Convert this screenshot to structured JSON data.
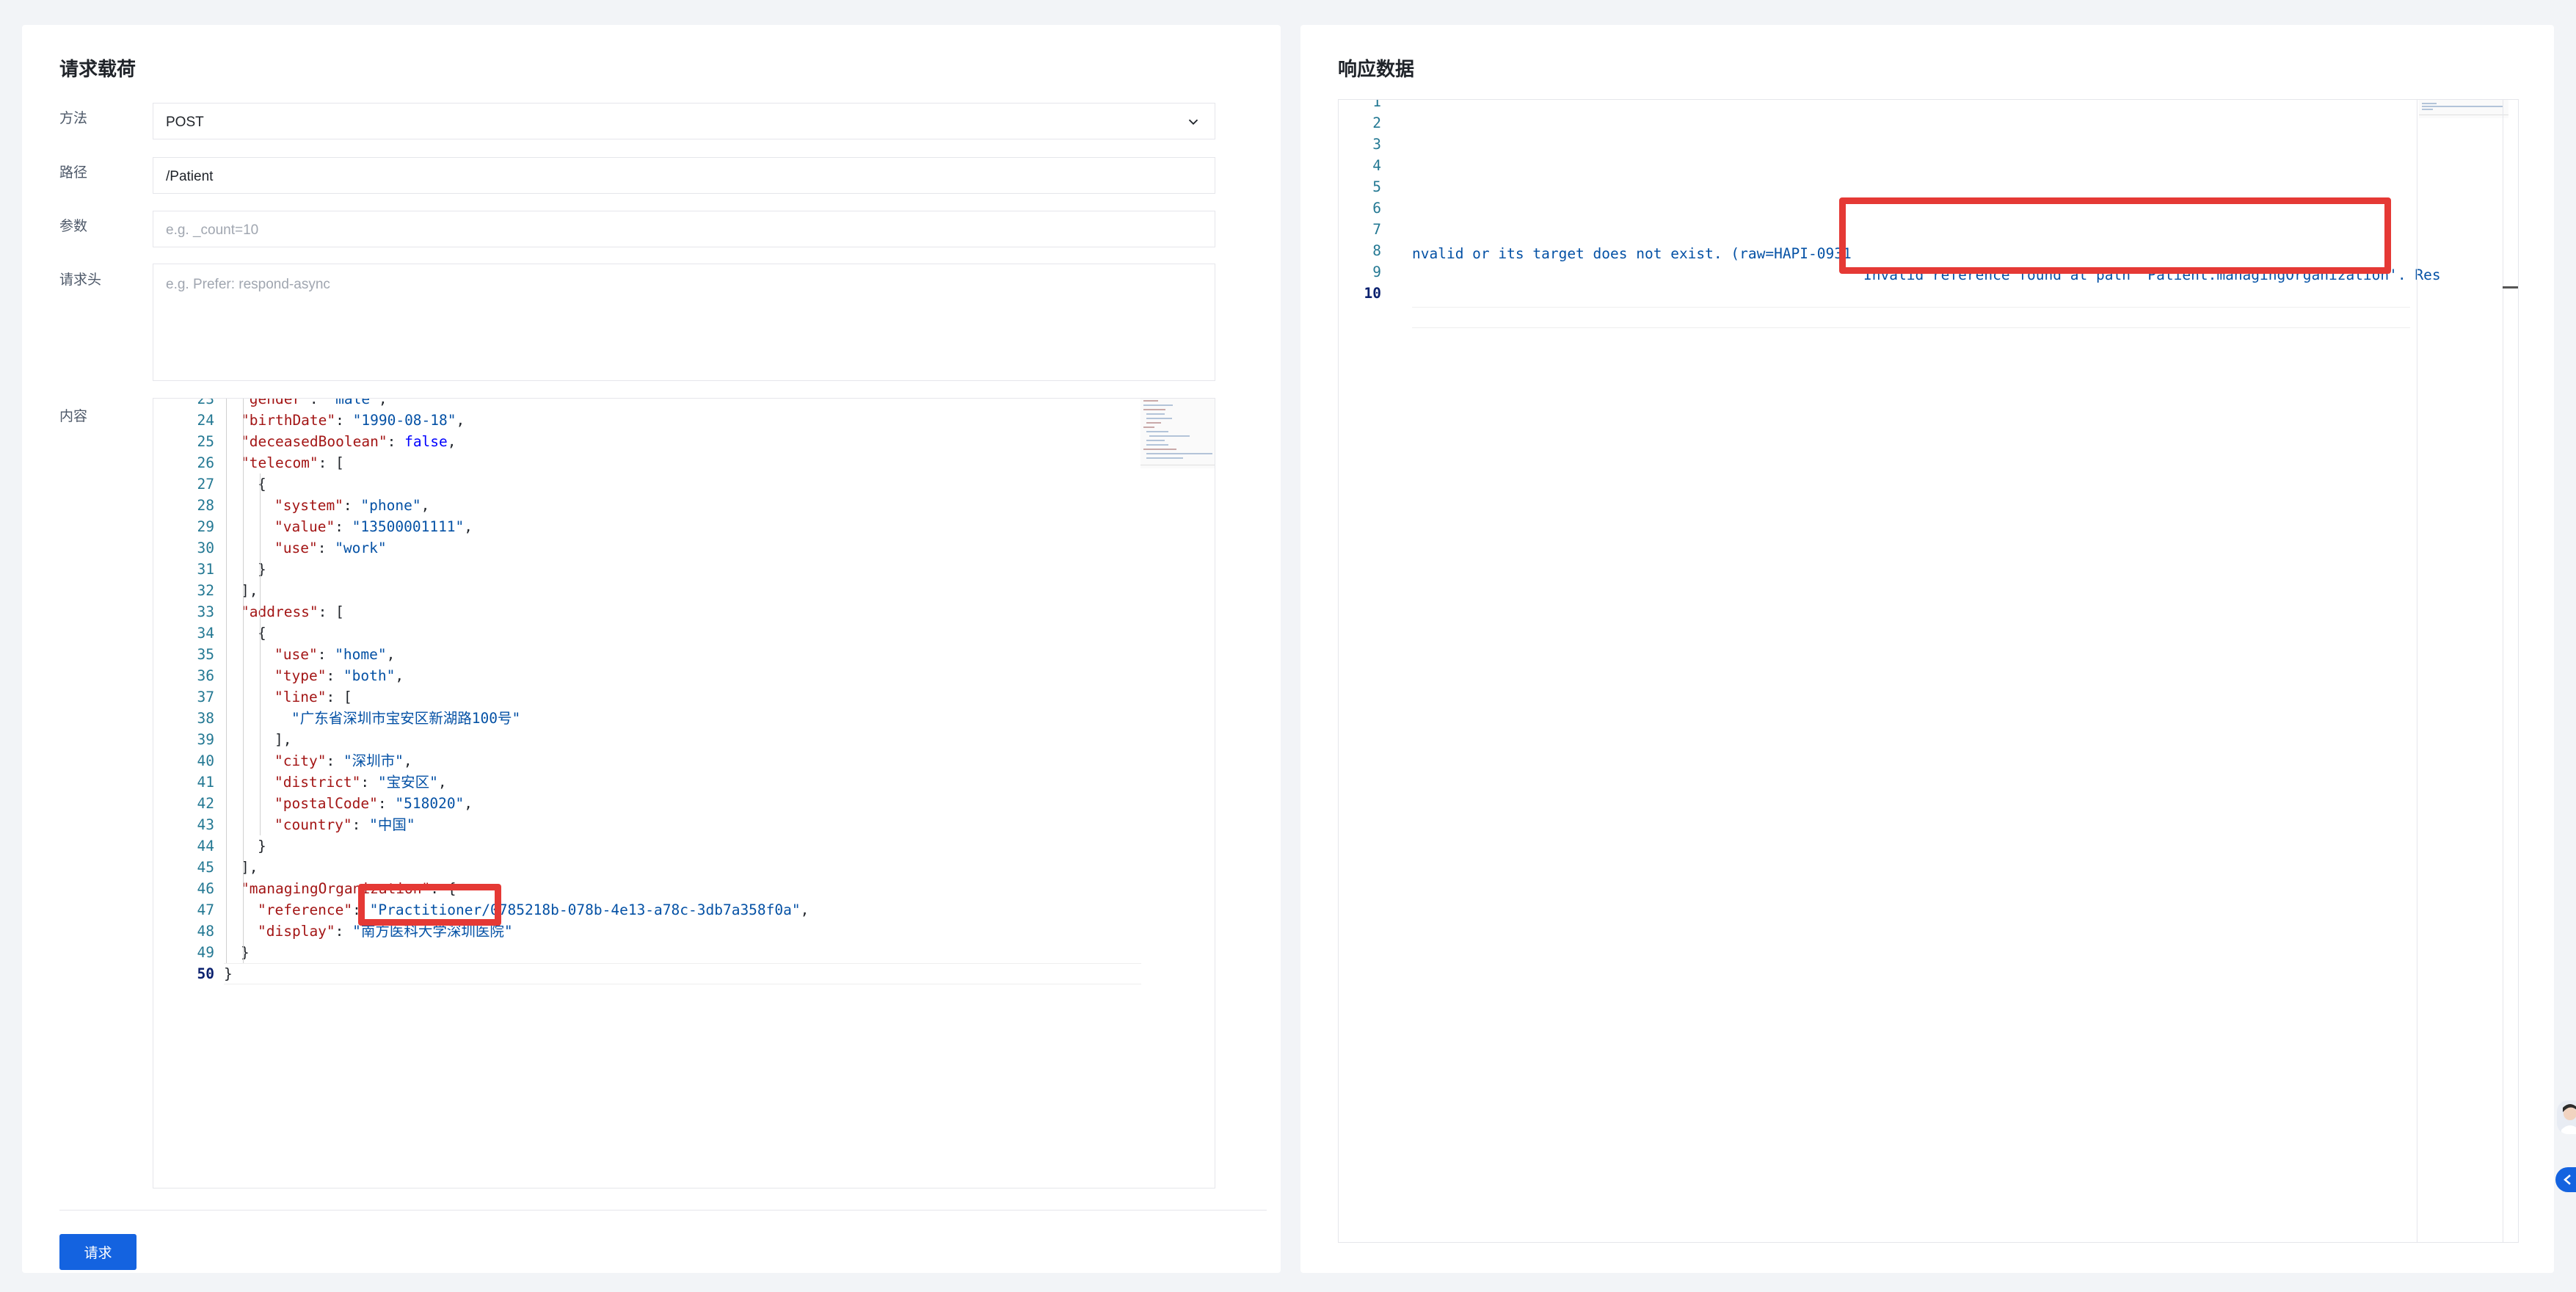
{
  "request": {
    "title": "请求载荷",
    "method_label": "方法",
    "method_value": "POST",
    "path_label": "路径",
    "path_value": "/Patient",
    "params_label": "参数",
    "params_placeholder": "e.g. _count=10",
    "headers_label": "请求头",
    "headers_placeholder": "e.g. Prefer: respond-async",
    "body_label": "内容",
    "submit_label": "请求"
  },
  "response": {
    "title": "响应数据",
    "line_numbers": [
      "1",
      "2",
      "3",
      "4",
      "5",
      "6",
      "7",
      "8",
      "9",
      "10"
    ],
    "line7_a": "nvalid or its target does not exist. (raw=HAPI-0931",
    "line7_b": "Invalid reference found at path 'Patient.managingOrganization'. Res"
  },
  "colors": {
    "accent": "#1463e0",
    "highlight_box": "#e53935",
    "json_key": "#a31515",
    "json_string": "#0451a5",
    "json_keyword": "#0000ff",
    "line_number": "#237893"
  },
  "icons": {
    "method_dropdown": "chevron-down-icon",
    "floating_avatar": "assistant-avatar-icon",
    "floating_button": "chevron-left-icon"
  },
  "body_lines": [
    {
      "n": "23",
      "indent": 1,
      "key": "gender",
      "value": "male",
      "vtype": "str",
      "tail": ","
    },
    {
      "n": "24",
      "indent": 1,
      "key": "birthDate",
      "value": "1990-08-18",
      "vtype": "str",
      "tail": ","
    },
    {
      "n": "25",
      "indent": 1,
      "key": "deceasedBoolean",
      "value": "false",
      "vtype": "kw",
      "tail": ","
    },
    {
      "n": "26",
      "indent": 1,
      "key": "telecom",
      "value": "",
      "vtype": "",
      "tail": "["
    },
    {
      "n": "27",
      "indent": 2,
      "key": "",
      "value": "",
      "vtype": "",
      "tail": "{"
    },
    {
      "n": "28",
      "indent": 3,
      "key": "system",
      "value": "phone",
      "vtype": "str",
      "tail": ","
    },
    {
      "n": "29",
      "indent": 3,
      "key": "value",
      "value": "13500001111",
      "vtype": "str",
      "tail": ","
    },
    {
      "n": "30",
      "indent": 3,
      "key": "use",
      "value": "work",
      "vtype": "str",
      "tail": ""
    },
    {
      "n": "31",
      "indent": 2,
      "key": "",
      "value": "",
      "vtype": "",
      "tail": "}"
    },
    {
      "n": "32",
      "indent": 1,
      "key": "",
      "value": "",
      "vtype": "",
      "tail": "],"
    },
    {
      "n": "33",
      "indent": 1,
      "key": "address",
      "value": "",
      "vtype": "",
      "tail": "["
    },
    {
      "n": "34",
      "indent": 2,
      "key": "",
      "value": "",
      "vtype": "",
      "tail": "{"
    },
    {
      "n": "35",
      "indent": 3,
      "key": "use",
      "value": "home",
      "vtype": "str",
      "tail": ","
    },
    {
      "n": "36",
      "indent": 3,
      "key": "type",
      "value": "both",
      "vtype": "str",
      "tail": ","
    },
    {
      "n": "37",
      "indent": 3,
      "key": "line",
      "value": "",
      "vtype": "",
      "tail": "["
    },
    {
      "n": "38",
      "indent": 4,
      "key": "",
      "value": "广东省深圳市宝安区新湖路100号",
      "vtype": "str",
      "tail": ""
    },
    {
      "n": "39",
      "indent": 3,
      "key": "",
      "value": "",
      "vtype": "",
      "tail": "],"
    },
    {
      "n": "40",
      "indent": 3,
      "key": "city",
      "value": "深圳市",
      "vtype": "str",
      "tail": ","
    },
    {
      "n": "41",
      "indent": 3,
      "key": "district",
      "value": "宝安区",
      "vtype": "str",
      "tail": ","
    },
    {
      "n": "42",
      "indent": 3,
      "key": "postalCode",
      "value": "518020",
      "vtype": "str",
      "tail": ","
    },
    {
      "n": "43",
      "indent": 3,
      "key": "country",
      "value": "中国",
      "vtype": "str",
      "tail": ""
    },
    {
      "n": "44",
      "indent": 2,
      "key": "",
      "value": "",
      "vtype": "",
      "tail": "}"
    },
    {
      "n": "45",
      "indent": 1,
      "key": "",
      "value": "",
      "vtype": "",
      "tail": "],"
    },
    {
      "n": "46",
      "indent": 1,
      "key": "managingOrganization",
      "value": "",
      "vtype": "",
      "tail": "{"
    },
    {
      "n": "47",
      "indent": 2,
      "key": "reference",
      "value": "Practitioner/0785218b-078b-4e13-a78c-3db7a358f0a",
      "vtype": "str",
      "tail": ","
    },
    {
      "n": "48",
      "indent": 2,
      "key": "display",
      "value": "南方医科大学深圳医院",
      "vtype": "str",
      "tail": ""
    },
    {
      "n": "49",
      "indent": 1,
      "key": "",
      "value": "",
      "vtype": "",
      "tail": "}"
    },
    {
      "n": "50",
      "indent": 0,
      "key": "",
      "value": "",
      "vtype": "",
      "tail": "}"
    }
  ]
}
